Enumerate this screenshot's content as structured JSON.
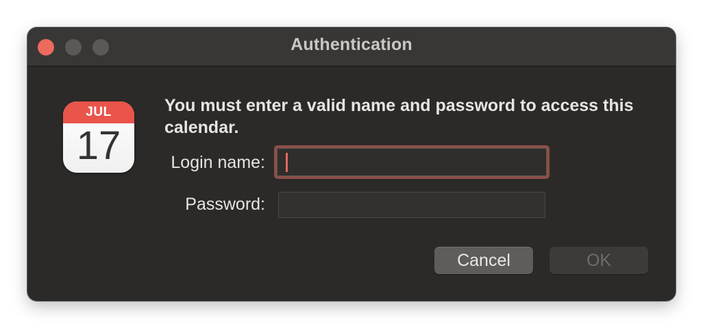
{
  "window": {
    "title": "Authentication",
    "controls": [
      "close",
      "minimize",
      "maximize"
    ]
  },
  "icon": {
    "name": "calendar-icon",
    "month": "JUL",
    "day": "17",
    "accent_color": "#e9554b"
  },
  "dialog": {
    "message": "You must enter a valid name and password to access this calendar.",
    "login": {
      "label": "Login name:",
      "value": "",
      "placeholder": "",
      "focused": true
    },
    "password": {
      "label": "Password:",
      "value": "",
      "placeholder": ""
    },
    "buttons": {
      "cancel_label": "Cancel",
      "ok_label": "OK",
      "ok_enabled": false
    }
  },
  "colors": {
    "close_button": "#ec6a5e",
    "focus_ring": "#8c4f48",
    "window_background": "#2c2a28"
  }
}
